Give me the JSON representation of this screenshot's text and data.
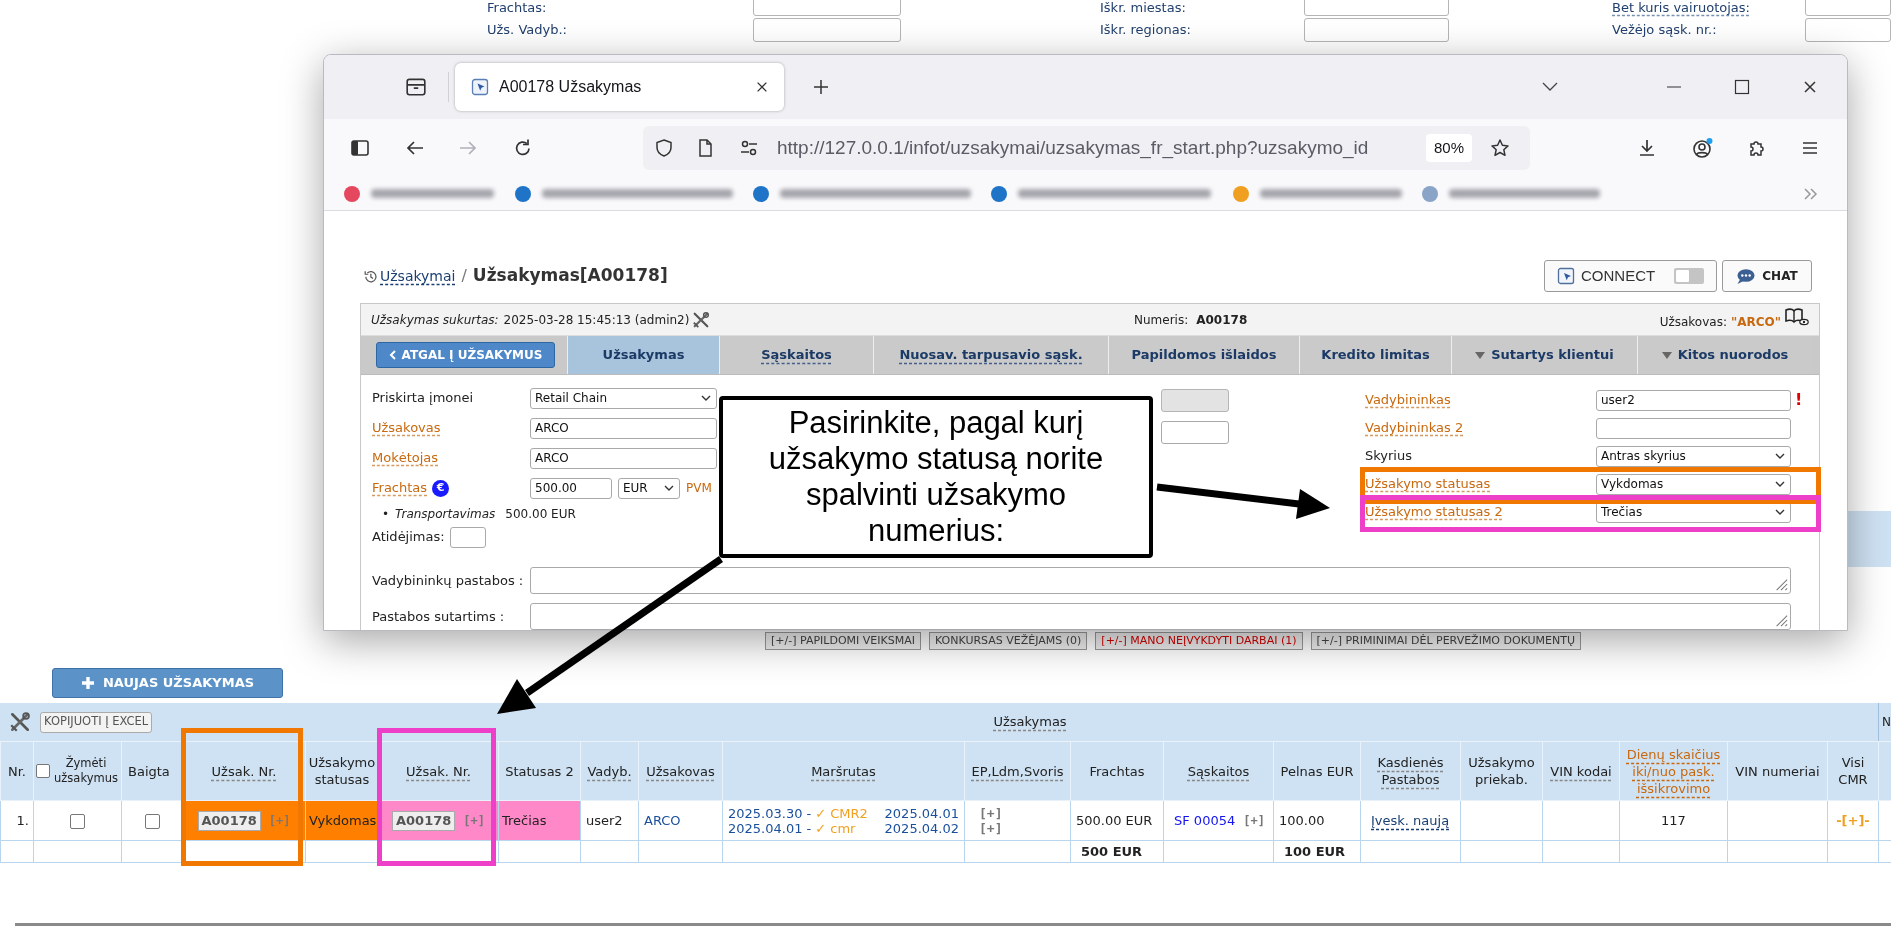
{
  "background_form": {
    "rows": [
      [
        {
          "label": "Frachtas:",
          "kind": "plain"
        },
        {
          "label": "Iškr. miestas:",
          "kind": "plain"
        },
        {
          "label": "Bet kuris vairuotojas:",
          "kind": "link"
        }
      ],
      [
        {
          "label": "Užs. Vadyb.:",
          "kind": "plain"
        },
        {
          "label": "Iškr. regionas:",
          "kind": "plain"
        },
        {
          "label": "Vežėjo sąsk. nr.:",
          "kind": "plain"
        }
      ]
    ]
  },
  "browser": {
    "tab_title": "A00178 Užsakymas",
    "can_go_forward": false,
    "url": "http://127.0.0.1/infot/uzsakymai/uzsakymas_fr_start.php?uzsakymo_id",
    "zoom": "80%",
    "bookmarks": [
      {
        "color": "#e5475e"
      },
      {
        "color": "#1f74c8"
      },
      {
        "color": "#1f74c8"
      },
      {
        "color": "#1f74c8"
      },
      {
        "color": "#f0a020"
      },
      {
        "color": "#8aa4c8"
      }
    ]
  },
  "page": {
    "breadcrumb": {
      "link": "Užsakymai",
      "separator": "/",
      "title": "Užsakymas[A00178]"
    },
    "connect_button": {
      "label": "CONNECT",
      "on": false
    },
    "chat_button": {
      "label": "CHAT"
    },
    "info": {
      "created_label": "Užsakymas sukurtas:",
      "created_value": "2025-03-28 15:45:13 (admin2)",
      "number_label": "Numeris:",
      "number_value": "A00178",
      "client_label": "Užsakovas:",
      "client_value": "\"ARCO\""
    },
    "back_button": {
      "label": "ATGAL Į UŽSAKYMUS"
    },
    "tabs": [
      {
        "label": "Užsakymas",
        "kind": "plain",
        "selected": true
      },
      {
        "label": "Sąskaitos",
        "kind": "link",
        "selected": false
      },
      {
        "label": "Nuosav. tarpusavio sąsk.",
        "kind": "link",
        "selected": false
      },
      {
        "label": "Papildomos išlaidos",
        "kind": "plain",
        "selected": false
      },
      {
        "label": "Kredito limitas",
        "kind": "plain",
        "selected": false
      },
      {
        "label": "Sutartys klientui",
        "kind": "dropdown",
        "selected": false
      },
      {
        "label": "Kitos nuorodos",
        "kind": "dropdown",
        "selected": false
      }
    ],
    "form": {
      "left_fields": [
        {
          "kind": "select",
          "label": "Priskirta įmonei",
          "link": false,
          "value": "Retail Chain"
        },
        {
          "kind": "input",
          "label": "Užsakovas",
          "link": true,
          "value": "ARCO"
        },
        {
          "kind": "input",
          "label": "Mokėtojas",
          "link": true,
          "value": "ARCO"
        },
        {
          "kind": "money",
          "label": "Frachtas",
          "link": true,
          "badge": "€",
          "value": "500.00",
          "currency": "EUR",
          "extra": "PVM"
        },
        {
          "kind": "breakdown",
          "bullet": "•",
          "label": "Transportavimas",
          "value": "500.00 EUR"
        },
        {
          "kind": "short_input",
          "label": "Atidėjimas:",
          "link": false
        }
      ],
      "middle_fields": [
        {
          "disabled": true
        },
        {
          "disabled": false
        }
      ],
      "right_fields": [
        {
          "kind": "input",
          "label": "Vadybininkas",
          "link": true,
          "value": "user2",
          "required_mark": "!"
        },
        {
          "kind": "input",
          "label": "Vadybininkas 2",
          "link": true
        },
        {
          "kind": "select",
          "label": "Skyrius",
          "link": false,
          "value": "Antras skyrius"
        },
        {
          "kind": "select",
          "label": "Užsakymo statusas",
          "link": true,
          "value": "Vykdomas",
          "highlight": {
            "color": "#f07800"
          }
        },
        {
          "kind": "select",
          "label": "Užsakymo statusas 2",
          "link": true,
          "value": "Trečias",
          "highlight": {
            "color": "#ee3fc8"
          }
        }
      ],
      "textareas": [
        {
          "label": "Vadybininkų pastabos :"
        },
        {
          "label": "Pastabos sutartims :"
        }
      ]
    }
  },
  "callout": {
    "text": "Pasirinkite, pagal kurį užsakymo statusą norite spalvinti užsakymo numerius:"
  },
  "background_actions": [
    {
      "label": "[+/-] PAPILDOMI VEIKSMAI",
      "alert": false
    },
    {
      "label": "KONKURSAS VEŽĖJAMS (0)",
      "alert": false
    },
    {
      "label": "[+/-] MANO NEĮVYKDYTI DARBAI (1)",
      "alert": true
    },
    {
      "label": "[+/-] PRIMINIMAI DĖL PERVEŽIMO DOKUMENTŲ",
      "alert": false
    }
  ],
  "new_order_button": {
    "label": "NAUJAS UŽSAKYMAS"
  },
  "table": {
    "excel_button": "KOPIJUOTI Į EXCEL",
    "group_header": "Užsakymas",
    "next_group_header": "N",
    "columns": [
      {
        "label": "Nr.",
        "kind": "plain"
      },
      {
        "label": "Žymėti užsakymus",
        "kind": "checkbox",
        "checked": false
      },
      {
        "label": "Baigta",
        "kind": "plain"
      },
      {
        "label": "Užsak. Nr.",
        "kind": "link",
        "highlight": {
          "color": "#f07800"
        }
      },
      {
        "label": "Užsakymo statusas",
        "kind": "plain"
      },
      {
        "label": "Užsak. Nr.",
        "kind": "link",
        "highlight": {
          "color": "#ee3fc8"
        }
      },
      {
        "label": "Statusas 2",
        "kind": "plain"
      },
      {
        "label": "Vadyb.",
        "kind": "link"
      },
      {
        "label": "Užsakovas",
        "kind": "link"
      },
      {
        "label": "Maršrutas",
        "kind": "link"
      },
      {
        "label": "EP,Ldm,Svoris",
        "kind": "link"
      },
      {
        "label": "Frachtas",
        "kind": "plain"
      },
      {
        "label": "Sąskaitos",
        "kind": "link"
      },
      {
        "label": "Pelnas EUR",
        "kind": "plain"
      },
      {
        "label": "Kasdienės Pastabos",
        "kind": "link"
      },
      {
        "label": "Užsakymo priekab.",
        "kind": "plain"
      },
      {
        "label": "VIN kodai",
        "kind": "link"
      },
      {
        "label": "Dienų skaičius iki/nuo pask. išsikrovimo",
        "kind": "accent"
      },
      {
        "label": "VIN numeriai",
        "kind": "plain"
      },
      {
        "label": "Visi CMR",
        "kind": "plain"
      }
    ],
    "rows": [
      {
        "cells": [
          {
            "kind": "index",
            "text": "1."
          },
          {
            "kind": "checkbox",
            "checked": false
          },
          {
            "kind": "checkbox",
            "checked": false
          },
          {
            "kind": "order",
            "number": "A00178",
            "action": "[+]",
            "color": "#ff8000"
          },
          {
            "kind": "status",
            "text": "Vykdomas",
            "color": "#ff8000"
          },
          {
            "kind": "order",
            "number": "A00178",
            "action": "[+]",
            "color": "#ff88c8"
          },
          {
            "kind": "status",
            "text": "Trečias",
            "color": "#ff88c8"
          },
          {
            "kind": "text",
            "text": "user2"
          },
          {
            "kind": "link",
            "text": "ARCO"
          },
          {
            "kind": "route",
            "legs": [
              {
                "start": "2025.03.30 -",
                "cmr": "✓ CMR2",
                "end": "2025.04.01"
              },
              {
                "start": "2025.04.01 -",
                "cmr": "✓ cmr",
                "end": "2025.04.02"
              }
            ]
          },
          {
            "kind": "actions",
            "items": [
              "[+]",
              "[+]"
            ]
          },
          {
            "kind": "text",
            "text": "500.00 EUR"
          },
          {
            "kind": "invoice",
            "text": "SF 00054",
            "action": "[+]"
          },
          {
            "kind": "text",
            "text": "100.00"
          },
          {
            "kind": "dashed_link",
            "text": "Įvesk. naują"
          },
          {
            "kind": "empty"
          },
          {
            "kind": "empty"
          },
          {
            "kind": "center",
            "text": "117"
          },
          {
            "kind": "empty"
          },
          {
            "kind": "accent",
            "text": "-[+]-"
          }
        ]
      }
    ],
    "totals": {
      "cells": [
        {
          "kind": "empty"
        },
        {
          "kind": "empty"
        },
        {
          "kind": "empty"
        },
        {
          "kind": "empty"
        },
        {
          "kind": "empty"
        },
        {
          "kind": "empty"
        },
        {
          "kind": "empty"
        },
        {
          "kind": "empty"
        },
        {
          "kind": "empty"
        },
        {
          "kind": "empty"
        },
        {
          "kind": "empty"
        },
        {
          "kind": "bold",
          "text": "500 EUR"
        },
        {
          "kind": "empty"
        },
        {
          "kind": "bold",
          "text": "100 EUR"
        },
        {
          "kind": "empty"
        },
        {
          "kind": "empty"
        },
        {
          "kind": "empty"
        },
        {
          "kind": "empty"
        },
        {
          "kind": "empty"
        },
        {
          "kind": "empty"
        }
      ]
    }
  }
}
